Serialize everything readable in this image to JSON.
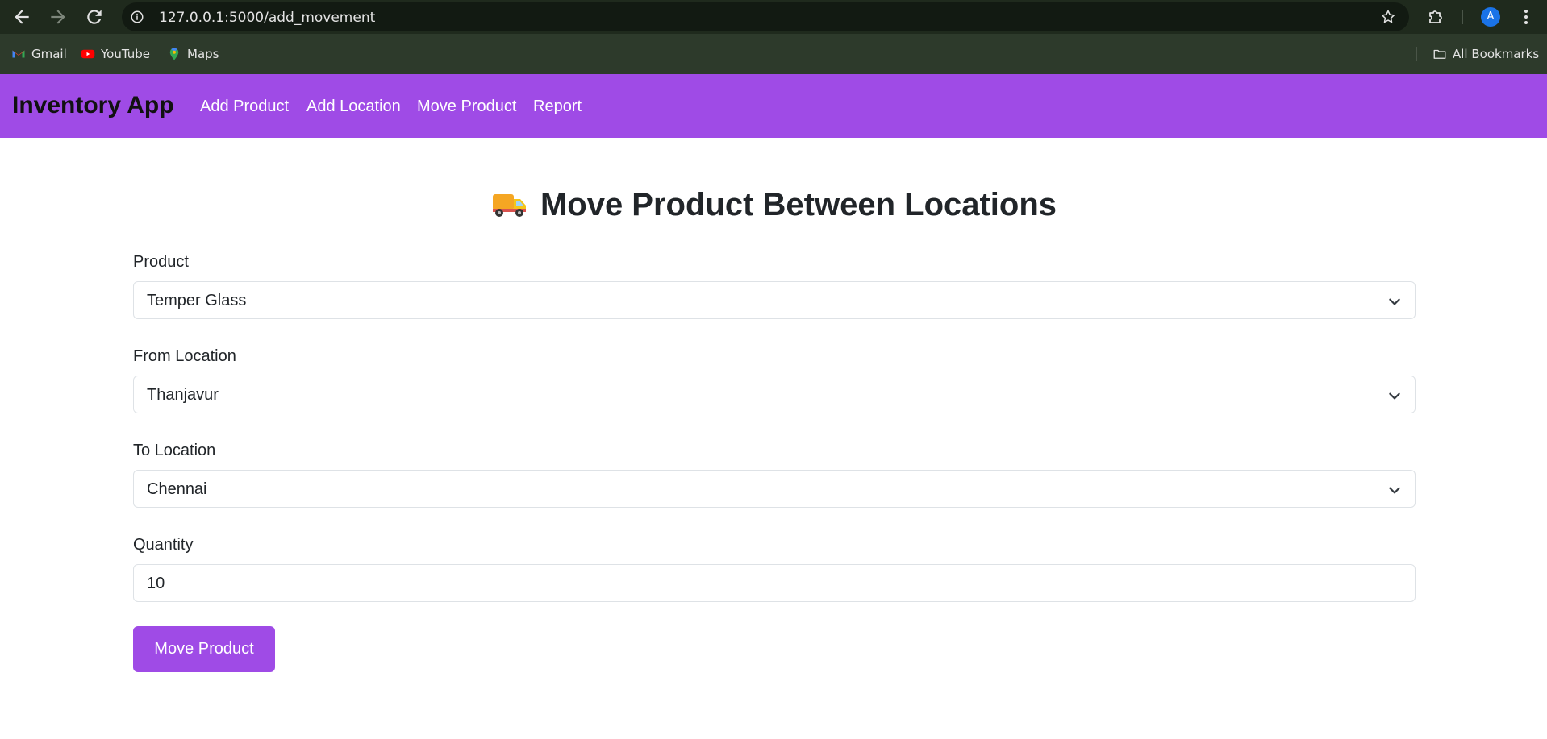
{
  "browser": {
    "url": "127.0.0.1:5000/add_movement",
    "profile_initial": "A",
    "bookmarks": [
      {
        "label": "Gmail",
        "icon": "gmail-icon"
      },
      {
        "label": "YouTube",
        "icon": "youtube-icon"
      },
      {
        "label": "Maps",
        "icon": "maps-icon"
      }
    ],
    "all_bookmarks_label": "All Bookmarks"
  },
  "navbar": {
    "brand": "Inventory App",
    "links": [
      "Add Product",
      "Add Location",
      "Move Product",
      "Report"
    ],
    "color": "#9f4be6"
  },
  "page": {
    "title": "Move Product Between Locations",
    "title_icon": "delivery-truck-icon"
  },
  "form": {
    "product": {
      "label": "Product",
      "value": "Temper Glass"
    },
    "from_location": {
      "label": "From Location",
      "value": "Thanjavur"
    },
    "to_location": {
      "label": "To Location",
      "value": "Chennai"
    },
    "quantity": {
      "label": "Quantity",
      "value": "10"
    },
    "submit_label": "Move Product"
  }
}
